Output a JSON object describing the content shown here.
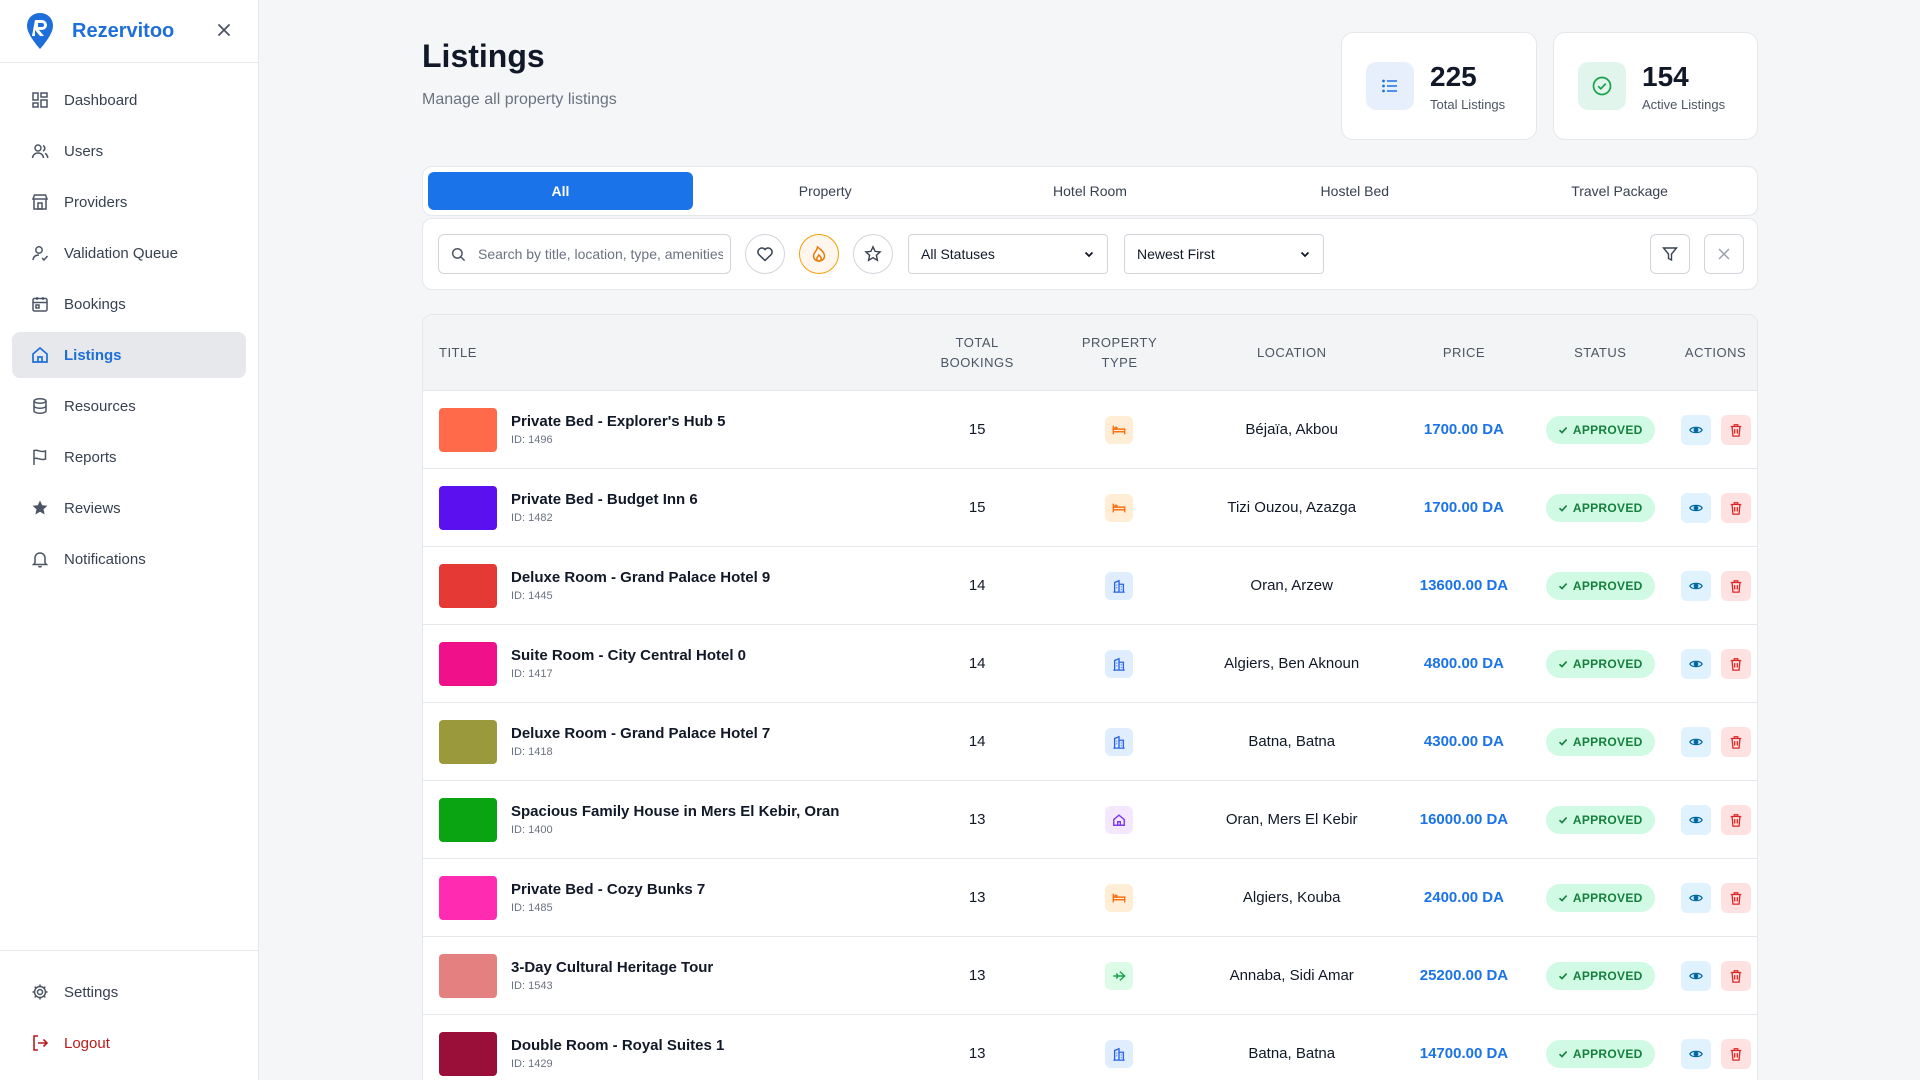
{
  "app": {
    "name": "Rezervitoo"
  },
  "sidebar": {
    "items": [
      {
        "label": "Dashboard",
        "icon": "dashboard-icon"
      },
      {
        "label": "Users",
        "icon": "users-icon"
      },
      {
        "label": "Providers",
        "icon": "store-icon"
      },
      {
        "label": "Validation Queue",
        "icon": "user-check-icon"
      },
      {
        "label": "Bookings",
        "icon": "calendar-icon"
      },
      {
        "label": "Listings",
        "icon": "home-icon",
        "active": true
      },
      {
        "label": "Resources",
        "icon": "database-icon"
      },
      {
        "label": "Reports",
        "icon": "flag-icon"
      },
      {
        "label": "Reviews",
        "icon": "star-icon"
      },
      {
        "label": "Notifications",
        "icon": "bell-icon"
      }
    ],
    "settings": "Settings",
    "logout": "Logout"
  },
  "header": {
    "title": "Listings",
    "subtitle": "Manage all property listings"
  },
  "stats": [
    {
      "value": "225",
      "label": "Total Listings",
      "icon": "list-icon"
    },
    {
      "value": "154",
      "label": "Active Listings",
      "icon": "check-circle-icon"
    }
  ],
  "tabs": [
    "All",
    "Property",
    "Hotel Room",
    "Hostel Bed",
    "Travel Package"
  ],
  "filters": {
    "search_placeholder": "Search by title, location, type, amenities",
    "status_selected": "All Statuses",
    "sort_selected": "Newest First"
  },
  "table": {
    "headers": {
      "title": "TITLE",
      "bookings": "TOTAL BOOKINGS",
      "type": "PROPERTY TYPE",
      "location": "LOCATION",
      "price": "PRICE",
      "status": "STATUS",
      "actions": "ACTIONS"
    },
    "rows": [
      {
        "title": "Private Bed - Explorer's Hub 5",
        "id": "ID: 1496",
        "bookings": "15",
        "type": "hostel-bed",
        "location": "Béjaïa, Akbou",
        "price": "1700.00 DA",
        "status": "APPROVED",
        "color": "#ff6b4a"
      },
      {
        "title": "Private Bed - Budget Inn 6",
        "id": "ID: 1482",
        "bookings": "15",
        "type": "hostel-bed",
        "location": "Tizi Ouzou, Azazga",
        "price": "1700.00 DA",
        "status": "APPROVED",
        "color": "#5b10f0"
      },
      {
        "title": "Deluxe Room - Grand Palace Hotel 9",
        "id": "ID: 1445",
        "bookings": "14",
        "type": "hotel-room",
        "location": "Oran, Arzew",
        "price": "13600.00 DA",
        "status": "APPROVED",
        "color": "#e53935"
      },
      {
        "title": "Suite Room - City Central Hotel 0",
        "id": "ID: 1417",
        "bookings": "14",
        "type": "hotel-room",
        "location": "Algiers, Ben Aknoun",
        "price": "4800.00 DA",
        "status": "APPROVED",
        "color": "#f0118a"
      },
      {
        "title": "Deluxe Room - Grand Palace Hotel 7",
        "id": "ID: 1418",
        "bookings": "14",
        "type": "hotel-room",
        "location": "Batna, Batna",
        "price": "4300.00 DA",
        "status": "APPROVED",
        "color": "#9a9a3c"
      },
      {
        "title": "Spacious Family House in Mers El Kebir, Oran",
        "id": "ID: 1400",
        "bookings": "13",
        "type": "property",
        "location": "Oran, Mers El Kebir",
        "price": "16000.00 DA",
        "status": "APPROVED",
        "color": "#0aa312"
      },
      {
        "title": "Private Bed - Cozy Bunks 7",
        "id": "ID: 1485",
        "bookings": "13",
        "type": "hostel-bed",
        "location": "Algiers, Kouba",
        "price": "2400.00 DA",
        "status": "APPROVED",
        "color": "#ff2bb0"
      },
      {
        "title": "3-Day Cultural Heritage Tour",
        "id": "ID: 1543",
        "bookings": "13",
        "type": "travel-package",
        "location": "Annaba, Sidi Amar",
        "price": "25200.00 DA",
        "status": "APPROVED",
        "color": "#e58080"
      },
      {
        "title": "Double Room - Royal Suites 1",
        "id": "ID: 1429",
        "bookings": "13",
        "type": "hotel-room",
        "location": "Batna, Batna",
        "price": "14700.00 DA",
        "status": "APPROVED",
        "color": "#990f3a"
      }
    ]
  },
  "colors": {
    "accent": "#1a73e8",
    "status_bg": "#d1fae5",
    "status_text": "#15803d",
    "hostel_bed": "#f97316",
    "hotel_room": "#2563eb",
    "property": "#7c3aed",
    "travel_package": "#16a34a"
  }
}
